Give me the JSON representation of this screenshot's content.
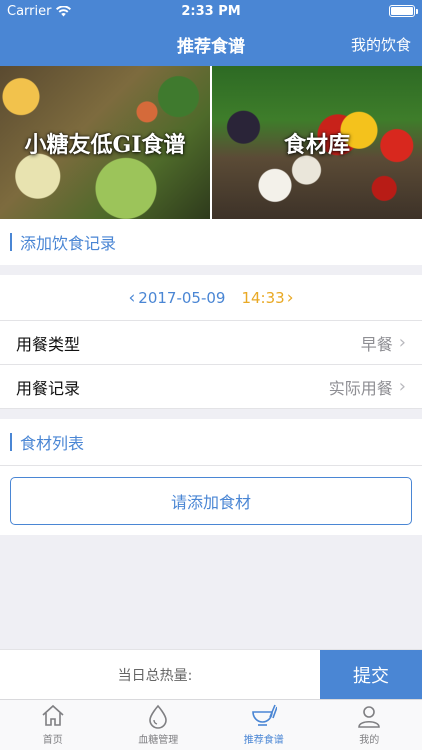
{
  "status": {
    "carrier": "Carrier",
    "time": "2:33 PM"
  },
  "nav": {
    "title": "推荐食谱",
    "right": "我的饮食"
  },
  "banners": [
    {
      "label": "小糖友低GI食谱"
    },
    {
      "label": "食材库"
    }
  ],
  "record_section": {
    "title": "添加饮食记录"
  },
  "datetime": {
    "date": "2017-05-09",
    "time": "14:33"
  },
  "meal_type": {
    "label": "用餐类型",
    "value": "早餐"
  },
  "meal_record": {
    "label": "用餐记录",
    "value": "实际用餐"
  },
  "food_section": {
    "title": "食材列表",
    "add_button": "请添加食材"
  },
  "bottom": {
    "kcal_label": "当日总热量:",
    "submit": "提交"
  },
  "tabs": [
    {
      "label": "首页",
      "icon": "home-icon",
      "active": false
    },
    {
      "label": "血糖管理",
      "icon": "blood-drop-icon",
      "active": false
    },
    {
      "label": "推荐食谱",
      "icon": "bowl-chopsticks-icon",
      "active": true
    },
    {
      "label": "我的",
      "icon": "person-icon",
      "active": false
    }
  ],
  "colors": {
    "primary": "#4a86d4",
    "accent_time": "#e9a925",
    "background": "#efeff4"
  }
}
